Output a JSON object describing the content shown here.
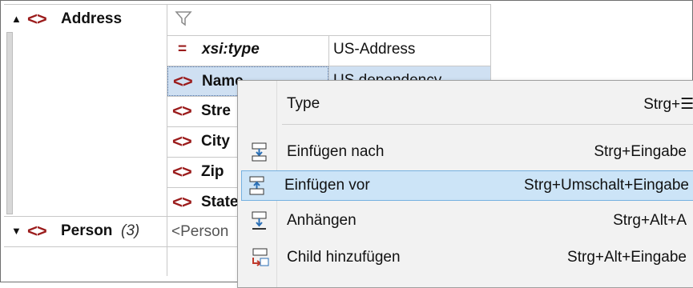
{
  "tree": {
    "address": {
      "label": "Address"
    },
    "person": {
      "label": "Person",
      "count": "(3)",
      "value": "<Person"
    },
    "xsitype": {
      "symbol": "=",
      "label": "xsi:type",
      "value": "US-Address"
    },
    "children": [
      {
        "label": "Name",
        "value": "US dependency"
      },
      {
        "label": "Stre"
      },
      {
        "label": "City"
      },
      {
        "label": "Zip"
      },
      {
        "label": "State"
      }
    ]
  },
  "context_menu": {
    "items": [
      {
        "label": "Type",
        "shortcut": "Strg+☰ ▸",
        "icon": "none"
      },
      {
        "label": "Einfügen nach",
        "shortcut": "Strg+Eingabe",
        "icon": "insert-after-icon"
      },
      {
        "label": "Einfügen vor",
        "shortcut": "Strg+Umschalt+Eingabe",
        "icon": "insert-before-icon",
        "highlighted": true
      },
      {
        "label": "Anhängen",
        "shortcut": "Strg+Alt+A",
        "icon": "append-icon"
      },
      {
        "label": "Child hinzufügen",
        "shortcut": "Strg+Alt+Eingabe",
        "icon": "add-child-icon"
      }
    ]
  },
  "colors": {
    "element_bracket": "#9b1c1c",
    "selection": "#cfe0f2",
    "menu_highlight": "#cce4f7"
  }
}
